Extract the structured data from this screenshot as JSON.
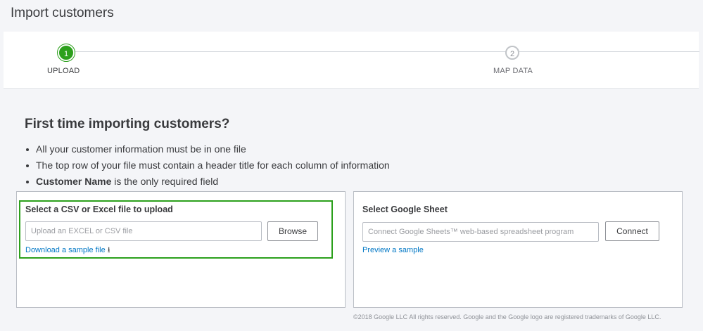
{
  "page": {
    "title": "Import customers"
  },
  "stepper": {
    "steps": [
      {
        "number": "1",
        "label": "UPLOAD",
        "state": "active"
      },
      {
        "number": "2",
        "label": "MAP DATA",
        "state": "inactive"
      }
    ]
  },
  "intro": {
    "heading": "First time importing customers?",
    "bullets": [
      {
        "text": "All your customer information must be in one file"
      },
      {
        "text": "The top row of your file must contain a header title for each column of information"
      },
      {
        "bold": "Customer Name",
        "text": " is the only required field"
      }
    ]
  },
  "upload_panel": {
    "title": "Select a CSV or Excel file to upload",
    "input_placeholder": "Upload an EXCEL or CSV file",
    "input_value": "",
    "button_label": "Browse",
    "download_link": "Download a sample file",
    "download_icon": "download-arrow-icon"
  },
  "sheets_panel": {
    "title": "Select Google Sheet",
    "input_placeholder": "Connect Google Sheets™ web-based spreadsheet program",
    "input_value": "",
    "button_label": "Connect",
    "preview_link": "Preview a sample"
  },
  "footer": {
    "copyright": "©2018 Google LLC All rights reserved. Google and the Google logo are registered trademarks of Google LLC."
  },
  "colors": {
    "accent_green": "#2ca01c",
    "link_blue": "#0077c5",
    "background": "#f4f5f8"
  }
}
